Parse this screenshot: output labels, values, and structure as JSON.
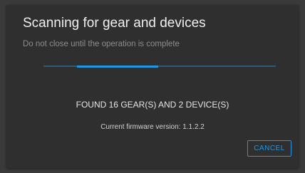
{
  "dialog": {
    "title": "Scanning for gear and devices",
    "subtitle": "Do not close until the operation is complete",
    "progress": 0.35,
    "found_text": "FOUND 16 GEAR(S) AND 2 DEVICE(S)",
    "firmware_text": "Current firmware version: 1.1.2.2",
    "cancel_label": "CANCEL"
  },
  "colors": {
    "background": "#3a3a3a",
    "dialog": "#2f2f2f",
    "accent": "#2196e3",
    "track": "#2c5a78"
  }
}
